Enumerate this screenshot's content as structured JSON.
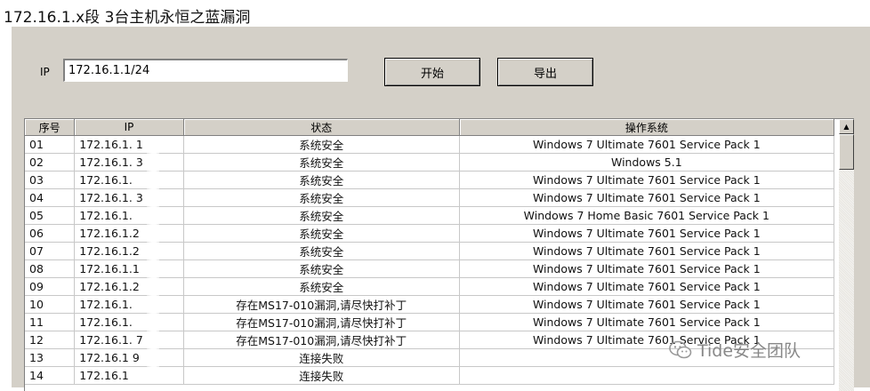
{
  "page": {
    "title": "172.16.1.x段 3台主机永恒之蓝漏洞"
  },
  "form": {
    "ip_label": "IP",
    "ip_value": "172.16.1.1/24",
    "start_button": "开始",
    "export_button": "导出"
  },
  "table": {
    "headers": [
      "序号",
      "IP",
      "状态",
      "操作系统"
    ],
    "rows": [
      {
        "no": "01",
        "ip": "172.16.1.  1",
        "status": "系统安全",
        "os": "Windows 7 Ultimate 7601 Service Pack 1"
      },
      {
        "no": "02",
        "ip": "172.16.1.  3",
        "status": "系统安全",
        "os": "Windows 5.1"
      },
      {
        "no": "03",
        "ip": "172.16.1.",
        "status": "系统安全",
        "os": "Windows 7 Ultimate 7601 Service Pack 1"
      },
      {
        "no": "04",
        "ip": "172.16.1.  3",
        "status": "系统安全",
        "os": "Windows 7 Ultimate 7601 Service Pack 1"
      },
      {
        "no": "05",
        "ip": "172.16.1.",
        "status": "系统安全",
        "os": "Windows 7 Home Basic 7601 Service Pack 1"
      },
      {
        "no": "06",
        "ip": "172.16.1.2",
        "status": "系统安全",
        "os": "Windows 7 Ultimate 7601 Service Pack 1"
      },
      {
        "no": "07",
        "ip": "172.16.1.2",
        "status": "系统安全",
        "os": "Windows 7 Ultimate 7601 Service Pack 1"
      },
      {
        "no": "08",
        "ip": "172.16.1.1",
        "status": "系统安全",
        "os": "Windows 7 Ultimate 7601 Service Pack 1"
      },
      {
        "no": "09",
        "ip": "172.16.1.2",
        "status": "系统安全",
        "os": "Windows 7 Ultimate 7601 Service Pack 1"
      },
      {
        "no": "10",
        "ip": "172.16.1.",
        "status": "存在MS17-010漏洞,请尽快打补丁",
        "os": "Windows 7 Ultimate 7601 Service Pack 1"
      },
      {
        "no": "11",
        "ip": "172.16.1.",
        "status": "存在MS17-010漏洞,请尽快打补丁",
        "os": "Windows 7 Ultimate 7601 Service Pack 1"
      },
      {
        "no": "12",
        "ip": "172.16.1.  7",
        "status": "存在MS17-010漏洞,请尽快打补丁",
        "os": "Windows 7 Ultimate 7601 Service Pack 1"
      },
      {
        "no": "13",
        "ip": "172.16.1  9",
        "status": "连接失败",
        "os": ""
      },
      {
        "no": "14",
        "ip": "172.16.1",
        "status": "连接失败",
        "os": ""
      }
    ]
  },
  "scrollbar": {
    "up_arrow": "▲"
  },
  "watermark": {
    "text": "Tide安全团队",
    "icon": "wechat-icon"
  }
}
